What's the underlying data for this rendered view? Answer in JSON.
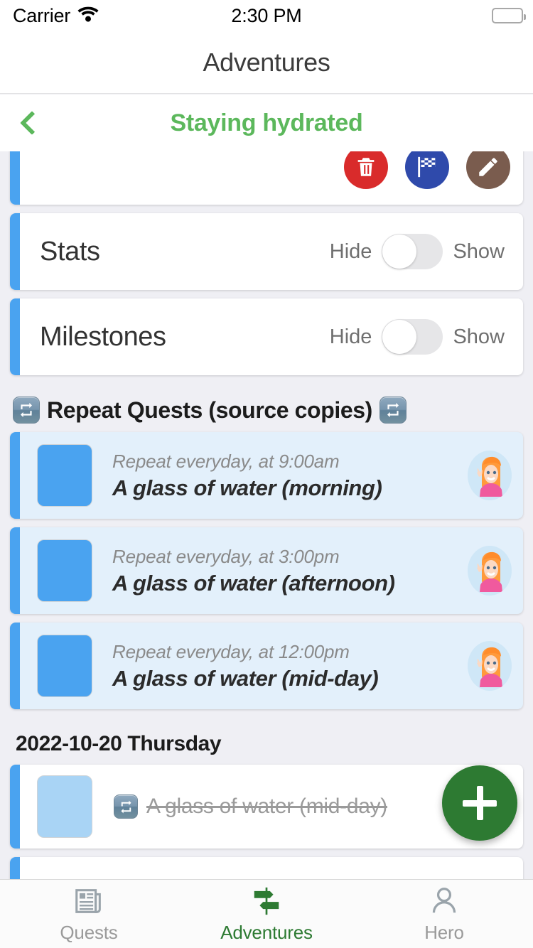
{
  "status_bar": {
    "carrier": "Carrier",
    "wifi_icon": "wifi-icon",
    "time": "2:30 PM",
    "battery_icon": "battery-full-icon"
  },
  "nav": {
    "title": "Adventures"
  },
  "sub_header": {
    "back_icon": "chevron-left-icon",
    "title": "Staying hydrated"
  },
  "actions": {
    "delete": {
      "label": "Delete",
      "icon": "trash-icon",
      "color": "#d92b2b"
    },
    "complete": {
      "label": "Complete",
      "icon": "checkered-flag-icon",
      "color": "#2f4aab"
    },
    "edit": {
      "label": "Edit",
      "icon": "pencil-icon",
      "color": "#7a5c4e"
    }
  },
  "toggles": [
    {
      "label": "Stats",
      "off_label": "Hide",
      "on_label": "Show",
      "state": "off"
    },
    {
      "label": "Milestones",
      "off_label": "Hide",
      "on_label": "Show",
      "state": "off"
    }
  ],
  "repeat_section": {
    "title": "Repeat Quests (source copies)",
    "left_icon": "repeat-icon",
    "right_icon": "repeat-icon",
    "quests": [
      {
        "schedule": "Repeat everyday, at 9:00am",
        "name": "A glass of water (morning)",
        "avatar": "hero-avatar"
      },
      {
        "schedule": "Repeat everyday, at 3:00pm",
        "name": "A glass of water (afternoon)",
        "avatar": "hero-avatar"
      },
      {
        "schedule": "Repeat everyday, at 12:00pm",
        "name": "A glass of water (mid-day)",
        "avatar": "hero-avatar"
      }
    ]
  },
  "day_section": {
    "date": "2022-10-20 Thursday",
    "quests": [
      {
        "name": "A glass of water (mid-day)",
        "repeat_icon": "repeat-icon",
        "completed": true
      }
    ]
  },
  "fab": {
    "label": "Add",
    "icon": "plus-icon",
    "color": "#2d7a32"
  },
  "tabbar": {
    "items": [
      {
        "label": "Quests",
        "icon": "newspaper-icon",
        "active": false
      },
      {
        "label": "Adventures",
        "icon": "signpost-icon",
        "active": true
      },
      {
        "label": "Hero",
        "icon": "person-icon",
        "active": false
      }
    ]
  },
  "colors": {
    "accent_green": "#5cb85c",
    "card_stripe_blue": "#4aa3f0",
    "quest_card_bg": "#e3f0fb",
    "page_bg": "#efeff4"
  }
}
